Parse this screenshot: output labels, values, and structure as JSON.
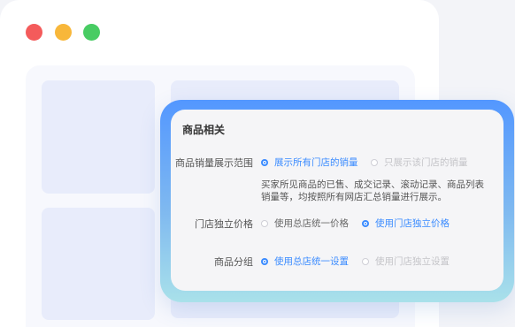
{
  "window": {
    "controls": [
      "close",
      "minimize",
      "maximize"
    ]
  },
  "panel": {
    "title": "商品相关",
    "rows": [
      {
        "label": "商品销量展示范围",
        "options": [
          {
            "text": "展示所有门店的销量",
            "selected": true
          },
          {
            "text": "只展示该门店的销量",
            "selected": false
          }
        ],
        "description": "买家所见商品的已售、成交记录、滚动记录、商品列表销量等，均按照所有网店汇总销量进行展示。"
      },
      {
        "label": "门店独立价格",
        "options": [
          {
            "text": "使用总店统一价格",
            "selected": false
          },
          {
            "text": "使用门店独立价格",
            "selected": true
          }
        ]
      },
      {
        "label": "商品分组",
        "options": [
          {
            "text": "使用总店统一设置",
            "selected": true
          },
          {
            "text": "使用门店独立设置",
            "selected": false
          }
        ]
      }
    ]
  },
  "colors": {
    "accent": "#3a8bff",
    "close": "#f45b5b",
    "minimize": "#f8b73a",
    "maximize": "#48cc63"
  }
}
